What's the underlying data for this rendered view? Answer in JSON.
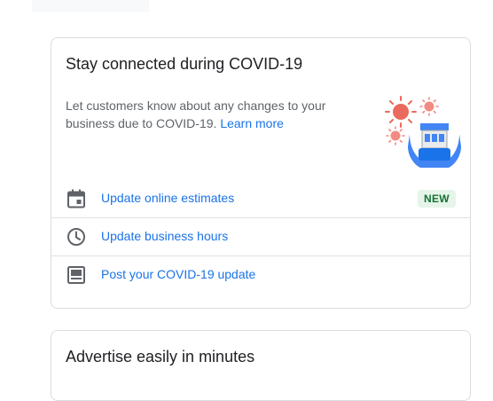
{
  "covid_card": {
    "title": "Stay connected during COVID-19",
    "description": "Let customers know about any changes to your business due to COVID-19. ",
    "learn_more": "Learn more",
    "actions": [
      {
        "label": "Update online estimates",
        "icon": "calendar-event-icon",
        "badge": "NEW"
      },
      {
        "label": "Update business hours",
        "icon": "clock-icon"
      },
      {
        "label": "Post your COVID-19 update",
        "icon": "post-icon"
      }
    ]
  },
  "ads_card": {
    "title": "Advertise easily in minutes"
  },
  "colors": {
    "link": "#1a73e8",
    "icon": "#5f6368",
    "badge_bg": "#e6f4ea",
    "badge_text": "#137333",
    "virus": "#ea6b5d"
  }
}
